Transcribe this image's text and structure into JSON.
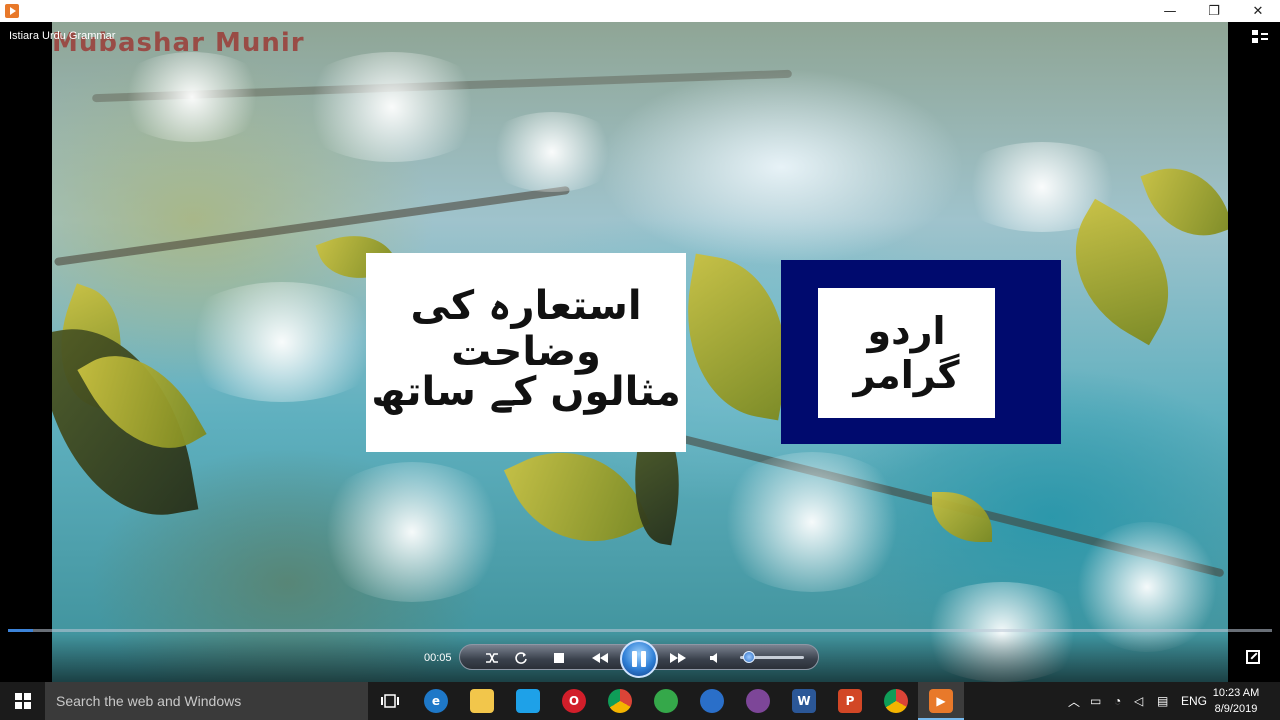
{
  "window": {
    "title": "Istiara Urdu Grammar",
    "minimize_glyph": "—",
    "restore_glyph": "❐",
    "close_glyph": "✕"
  },
  "video": {
    "watermark": "Mubashar Munir",
    "card_white": {
      "line1": "استعارہ کی وضاحت",
      "line2": "مثالوں کے ساتھ"
    },
    "card_blue": {
      "text": "اردو گرامر"
    }
  },
  "player": {
    "elapsed": "00:05",
    "progress_fraction": 0.02,
    "volume_fraction": 0.08,
    "icons": [
      "switch-to-library-icon",
      "shuffle-icon",
      "repeat-icon",
      "stop-icon",
      "previous-icon",
      "pause-icon",
      "next-icon",
      "volume-icon",
      "fullscreen-icon"
    ],
    "accent_color": "#2f7fd6"
  },
  "taskbar": {
    "search_placeholder": "Search the web and Windows",
    "apps": [
      "task-view",
      "edge",
      "file-explorer",
      "app-store",
      "opera",
      "chrome",
      "network-app",
      "app-blue",
      "tor-browser",
      "word",
      "powerpoint",
      "chrome-2",
      "windows-media-player"
    ],
    "tray": {
      "language": "ENG",
      "time": "10:23 AM",
      "date": "8/9/2019"
    }
  }
}
